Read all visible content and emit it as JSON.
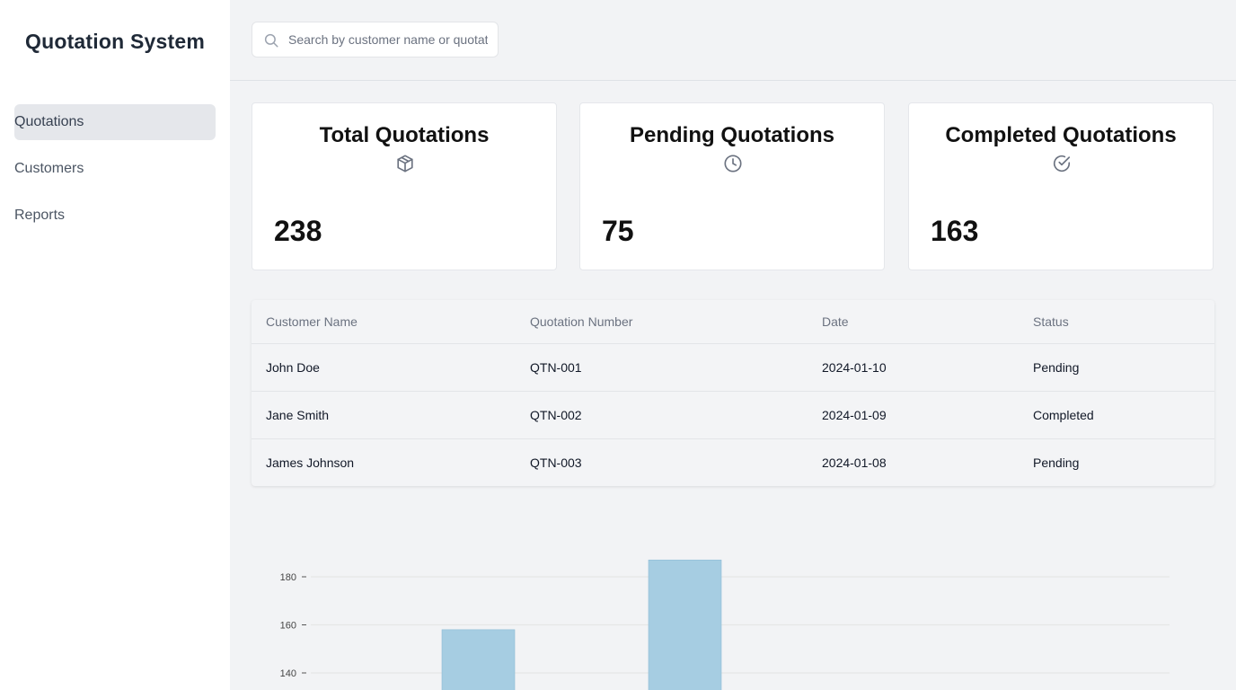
{
  "app": {
    "title": "Quotation System"
  },
  "sidebar": {
    "items": [
      {
        "label": "Quotations",
        "active": true
      },
      {
        "label": "Customers",
        "active": false
      },
      {
        "label": "Reports",
        "active": false
      }
    ]
  },
  "search": {
    "placeholder": "Search by customer name or quotation number"
  },
  "stats": [
    {
      "title": "Total Quotations",
      "icon": "package-icon",
      "value": "238"
    },
    {
      "title": "Pending Quotations",
      "icon": "clock-icon",
      "value": "75"
    },
    {
      "title": "Completed Quotations",
      "icon": "check-circle-icon",
      "value": "163"
    }
  ],
  "table": {
    "headers": [
      "Customer Name",
      "Quotation Number",
      "Date",
      "Status"
    ],
    "rows": [
      [
        "John Doe",
        "QTN-001",
        "2024-01-10",
        "Pending"
      ],
      [
        "Jane Smith",
        "QTN-002",
        "2024-01-09",
        "Completed"
      ],
      [
        "James Johnson",
        "QTN-003",
        "2024-01-08",
        "Pending"
      ]
    ]
  },
  "colors": {
    "bar": "#a6cde2",
    "grid": "#e6e6e6",
    "sidebar_active": "#e5e7eb"
  },
  "chart_data": {
    "type": "bar",
    "values": [
      158,
      187
    ],
    "y_ticks": [
      140,
      160,
      180
    ],
    "y_visible_range": [
      134,
      192
    ],
    "grid": true
  }
}
